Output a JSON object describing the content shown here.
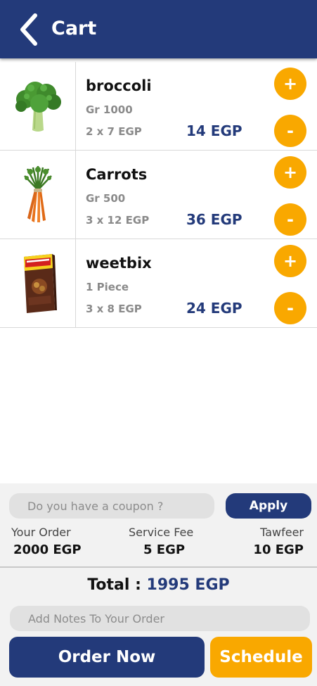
{
  "header": {
    "title": "Cart",
    "back_icon": "chevron-left-icon"
  },
  "colors": {
    "primary": "#233a7a",
    "accent": "#f9a800"
  },
  "items": [
    {
      "name": "broccoli",
      "weight": "Gr 1000",
      "qty": "2 x 7 EGP",
      "price": "14 EGP",
      "image": "broccoli-image",
      "plus_label": "+",
      "minus_label": "-"
    },
    {
      "name": "Carrots",
      "weight": "Gr 500",
      "qty": "3 x 12 EGP",
      "price": "36 EGP",
      "image": "carrots-image",
      "plus_label": "+",
      "minus_label": "-"
    },
    {
      "name": "weetbix",
      "weight": "1 Piece",
      "qty": "3 x 8 EGP",
      "price": "24 EGP",
      "image": "weetbix-box-image",
      "plus_label": "+",
      "minus_label": "-"
    }
  ],
  "coupon": {
    "placeholder": "Do you have a coupon ?",
    "apply_label": "Apply"
  },
  "summary": {
    "order_label": "Your Order",
    "order_value": "2000 EGP",
    "service_label": "Service Fee",
    "service_value": "5 EGP",
    "tawfeer_label": "Tawfeer",
    "tawfeer_value": "10 EGP"
  },
  "total": {
    "label": "Total : ",
    "value": "1995 EGP"
  },
  "notes": {
    "placeholder": "Add Notes To Your Order"
  },
  "actions": {
    "order_label": "Order Now",
    "schedule_label": "Schedule"
  }
}
